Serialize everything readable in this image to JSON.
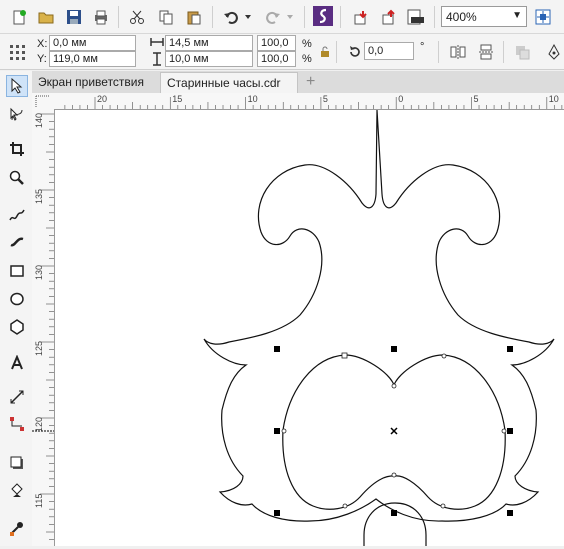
{
  "toolbar": {
    "zoom": "400%",
    "icons": [
      "new-document-icon",
      "open-icon",
      "save-icon",
      "print-icon",
      "cut-icon",
      "copy-icon",
      "paste-icon",
      "undo-icon",
      "redo-icon",
      "corel-connect-icon",
      "import-icon",
      "export-icon",
      "export-pdf-icon",
      "snap-to-icon"
    ]
  },
  "propertybar": {
    "x_label": "X:",
    "x_value": "0,0 мм",
    "y_label": "Y:",
    "y_value": "119,0 мм",
    "width_value": "14,5 мм",
    "height_value": "10,0 мм",
    "scale_x": "100,0",
    "scale_y": "100,0",
    "percent": "%",
    "rotation_value": "0,0",
    "degree": "°"
  },
  "tabs": [
    {
      "label": "Экран приветствия"
    },
    {
      "label": "Старинные часы.cdr"
    }
  ],
  "ruler": {
    "h_ticks": [
      "20",
      "15",
      "10",
      "5",
      "0",
      "5",
      "10"
    ],
    "v_ticks": [
      "140",
      "135",
      "130",
      "125",
      "120",
      "115"
    ]
  },
  "colors": {
    "accent": "#0067b8",
    "node": "#000000"
  }
}
